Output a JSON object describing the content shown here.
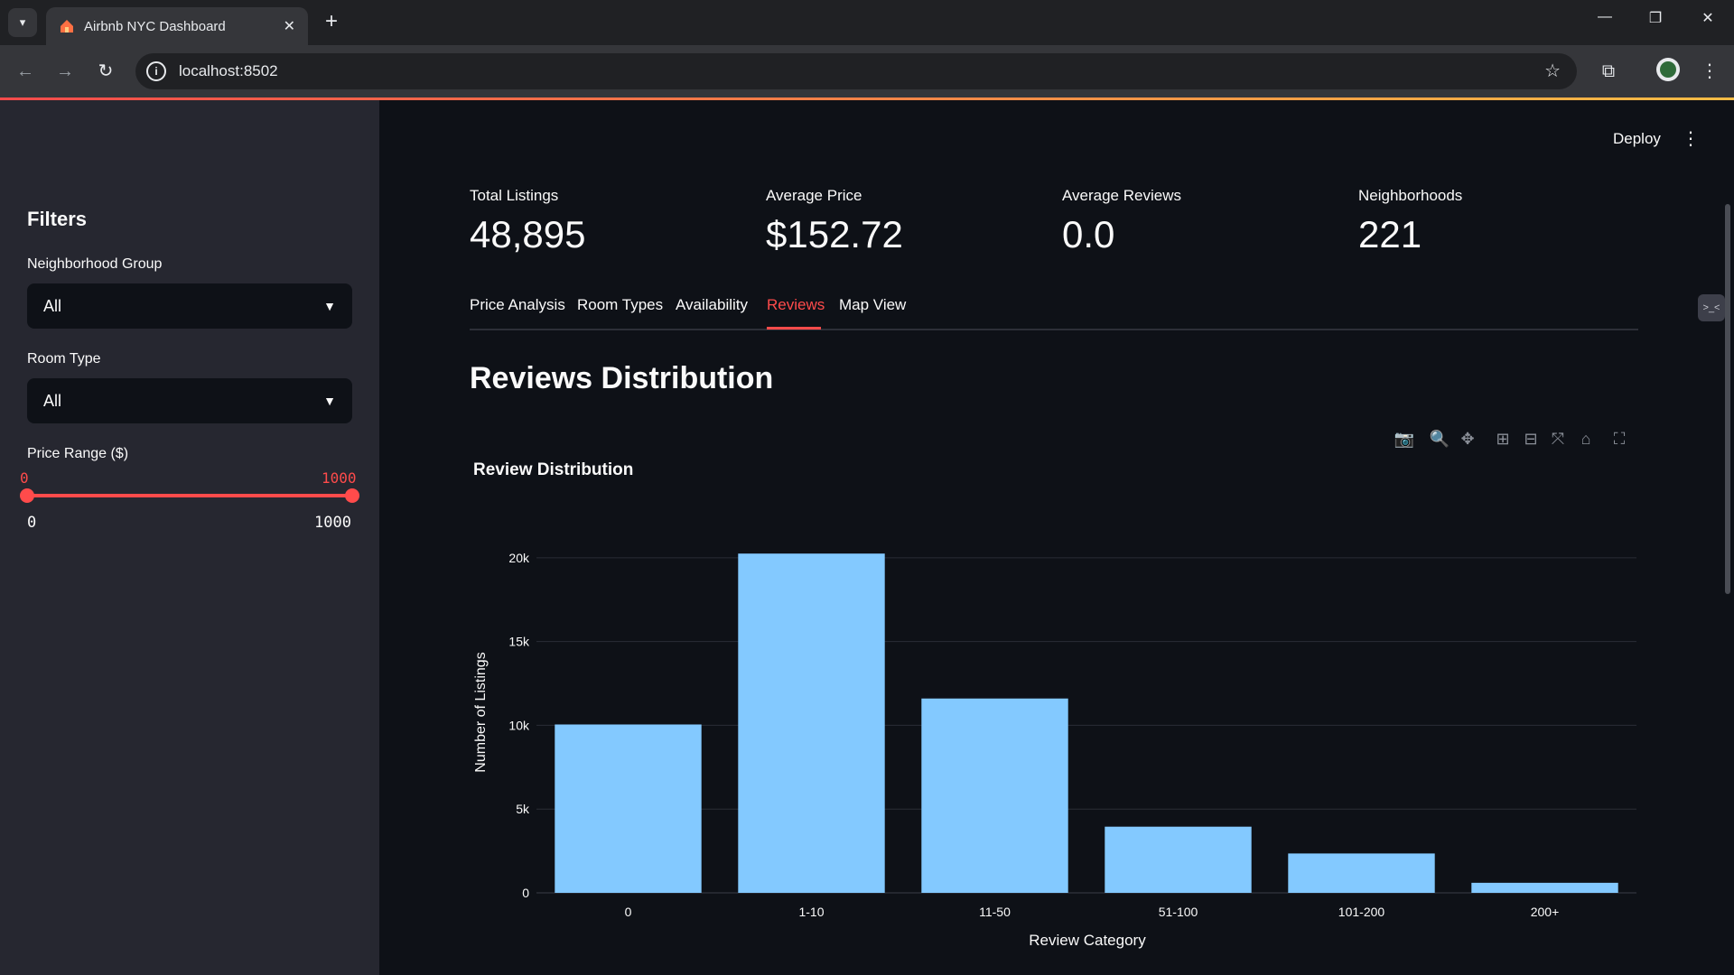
{
  "browser": {
    "tab_title": "Airbnb NYC Dashboard",
    "url": "localhost:8502"
  },
  "sidebar": {
    "title": "Filters",
    "neighborhood_label": "Neighborhood Group",
    "neighborhood_value": "All",
    "roomtype_label": "Room Type",
    "roomtype_value": "All",
    "price_label": "Price Range ($)",
    "price_min": "0",
    "price_max": "1000",
    "price_range_min": "0",
    "price_range_max": "1000"
  },
  "header": {
    "deploy_label": "Deploy"
  },
  "metrics": [
    {
      "label": "Total Listings",
      "value": "48,895"
    },
    {
      "label": "Average Price",
      "value": "$152.72"
    },
    {
      "label": "Average Reviews",
      "value": "0.0"
    },
    {
      "label": "Neighborhoods",
      "value": "221"
    }
  ],
  "tabs": [
    "Price Analysis",
    "Room Types",
    "Availability",
    "Reviews",
    "Map View"
  ],
  "active_tab": "Reviews",
  "section_title": "Reviews Distribution",
  "modebar_icons": [
    "camera-icon",
    "zoom-icon",
    "pan-icon",
    "zoom-in-icon",
    "zoom-out-icon",
    "autoscale-icon",
    "home-icon",
    "fullscreen-icon"
  ],
  "chart_data": {
    "type": "bar",
    "title": "Review Distribution",
    "xlabel": "Review Category",
    "ylabel": "Number of Listings",
    "categories": [
      "0",
      "1-10",
      "11-50",
      "51-100",
      "101-200",
      "200+"
    ],
    "values": [
      10050,
      20250,
      11600,
      3950,
      2350,
      600
    ],
    "ylim": [
      0,
      21500
    ],
    "yticks": [
      0,
      5000,
      10000,
      15000,
      20000
    ],
    "ytick_labels": [
      "0",
      "5k",
      "10k",
      "15k",
      "20k"
    ],
    "bar_color": "#83c9ff",
    "grid": true
  },
  "colors": {
    "accent": "#ff4b4b",
    "sidebar_bg": "#262730",
    "main_bg": "#0e1117"
  }
}
